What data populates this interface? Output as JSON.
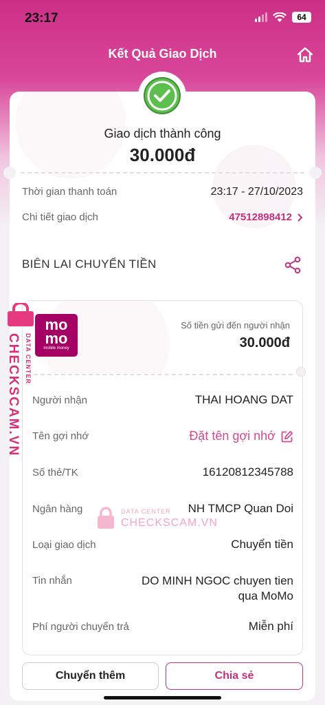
{
  "status_bar": {
    "time": "23:17",
    "battery": "64"
  },
  "header": {
    "title": "Kết Quả Giao Dịch"
  },
  "result": {
    "status": "Giao dịch thành công",
    "amount": "30.000đ"
  },
  "info": {
    "payment_time_label": "Thời gian thanh toán",
    "payment_time_value": "23:17 - 27/10/2023",
    "detail_label": "Chi tiết giao dịch",
    "detail_value": "47512898412"
  },
  "receipt": {
    "section_title": "BIÊN LAI CHUYỂN TIỀN",
    "logo_line1": "mo",
    "logo_line2": "mo",
    "logo_line3": "mobile money",
    "sent_label": "Số tiền gửi đến người nhận",
    "sent_amount": "30.000đ",
    "rows": [
      {
        "label": "Người nhận",
        "value": "THAI HOANG DAT"
      },
      {
        "label": "Tên gợi nhớ",
        "value": "Đặt tên gợi nhớ"
      },
      {
        "label": "Số thẻ/TK",
        "value": "16120812345788"
      },
      {
        "label": "Ngân hàng",
        "value": "NH TMCP Quan Doi"
      },
      {
        "label": "Loại giao dịch",
        "value": "Chuyển tiền"
      },
      {
        "label": "Tin nhắn",
        "value": "DO MINH NGOC chuyen tien",
        "value2": "qua MoMo"
      },
      {
        "label": "Phí người chuyển trả",
        "value": "Miễn phí"
      }
    ]
  },
  "buttons": {
    "more": "Chuyển thêm",
    "share": "Chia sẻ"
  },
  "watermark": {
    "left_small": "DATA CENTER",
    "left_big": "CHECKSCAM.VN",
    "center_small": "DATA CENTER",
    "center_big": "CHECKSCAM.VN"
  },
  "colors": {
    "brand": "#c1307c",
    "momo": "#a50064",
    "success": "#4caf50"
  },
  "icons": [
    "home-icon",
    "check-circle-icon",
    "share-icon",
    "edit-icon",
    "chevron-right-icon",
    "lock-icon"
  ]
}
